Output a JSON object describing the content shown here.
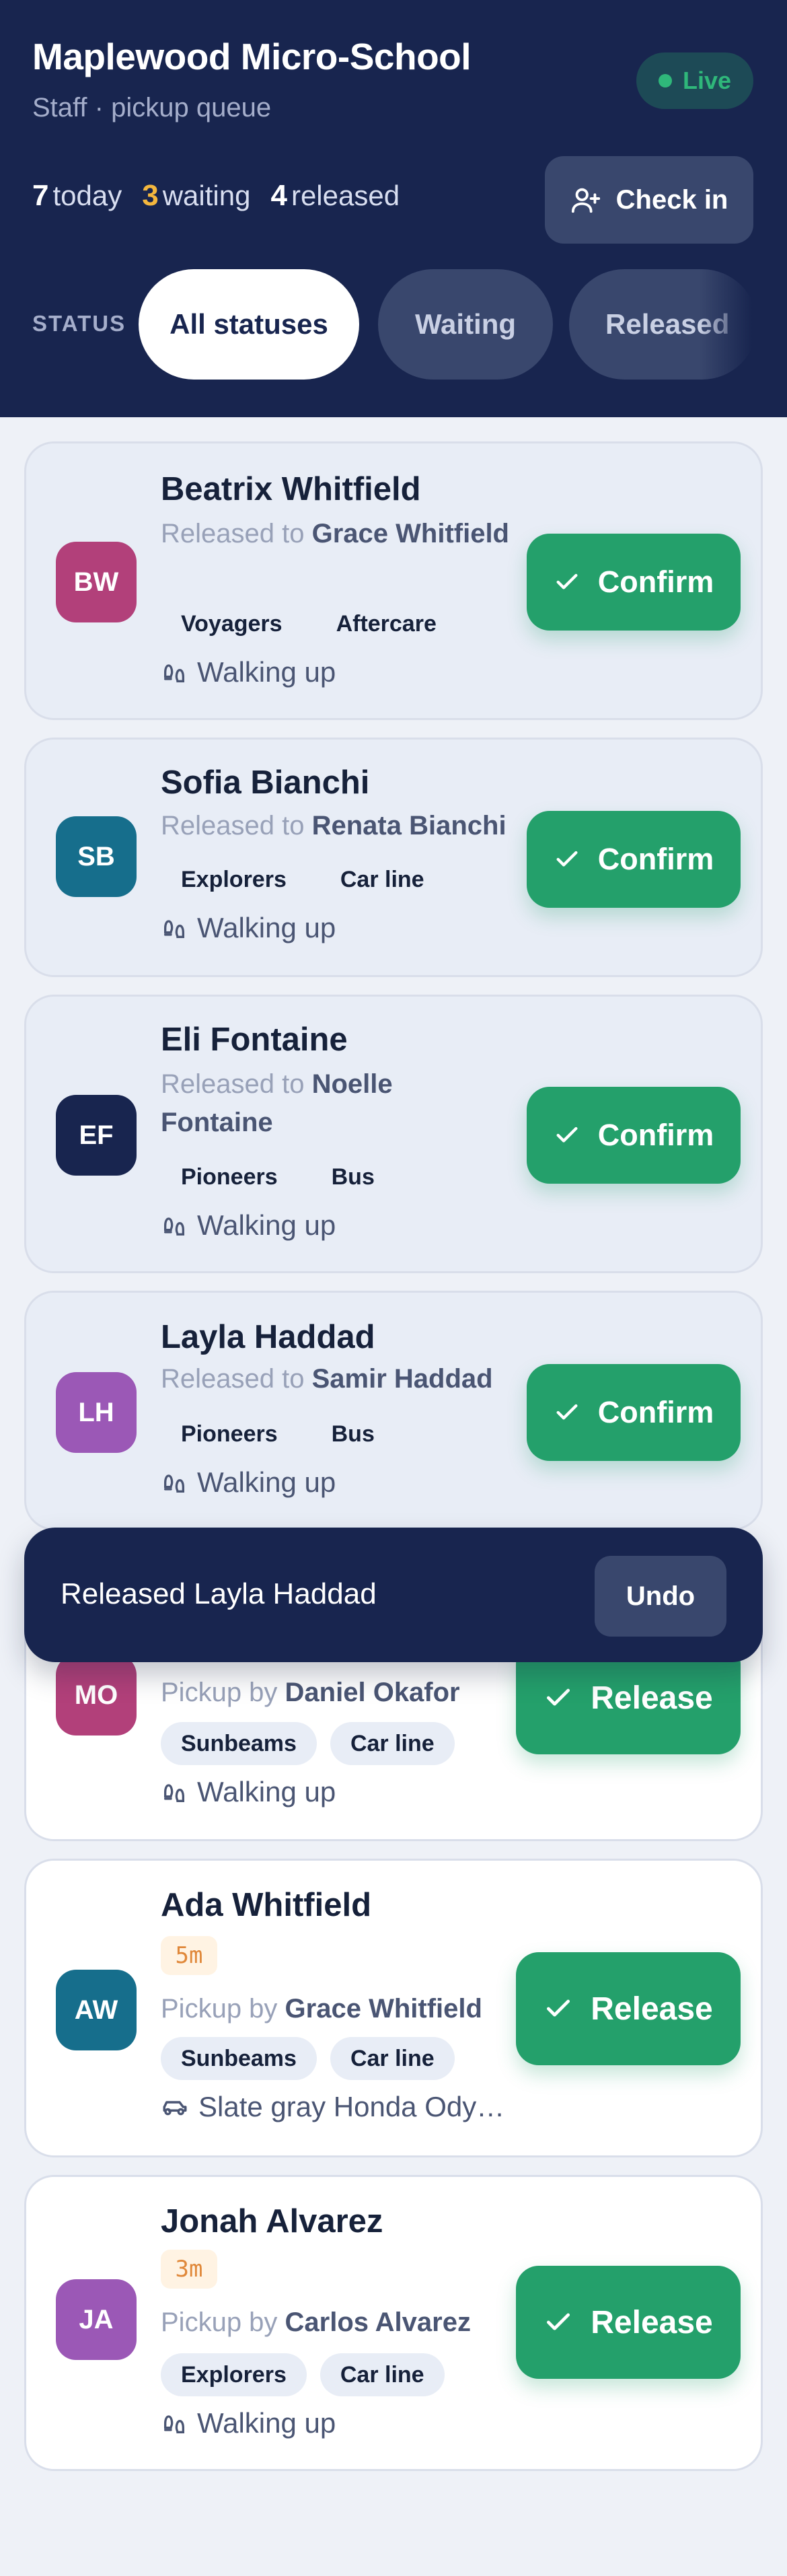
{
  "header": {
    "title": "Maplewood Micro-School",
    "subtitle": "Staff · pickup queue",
    "live_label": "Live",
    "counts": [
      {
        "num": "7",
        "label": "today"
      },
      {
        "num": "3",
        "label": "waiting"
      },
      {
        "num": "4",
        "label": "released"
      }
    ],
    "checkin_label": "Check in",
    "filter_label": "STATUS",
    "filters": [
      "All statuses",
      "Waiting",
      "Released"
    ]
  },
  "cards": [
    {
      "initials": "BW",
      "name": "Beatrix Whitfield",
      "prefix": "Released to",
      "person": "Grace Whitfield",
      "tags": [
        "Voyagers",
        "Aftercare"
      ],
      "arrival": "Walking up",
      "action": "Confirm",
      "avatar_color": "#b2407a"
    },
    {
      "initials": "SB",
      "name": "Sofia Bianchi",
      "prefix": "Released to",
      "person": "Renata Bianchi",
      "tags": [
        "Explorers",
        "Car line"
      ],
      "arrival": "Walking up",
      "action": "Confirm",
      "avatar_color": "#166e8c"
    },
    {
      "initials": "EF",
      "name": "Eli Fontaine",
      "prefix": "Released to",
      "person": "Noelle Fontaine",
      "tags": [
        "Pioneers",
        "Bus"
      ],
      "arrival": "Walking up",
      "action": "Confirm",
      "avatar_color": "#18254f"
    },
    {
      "initials": "LH",
      "name": "Layla Haddad",
      "prefix": "Released to",
      "person": "Samir Haddad",
      "tags": [
        "Pioneers",
        "Bus"
      ],
      "arrival": "Walking up",
      "action": "Confirm",
      "avatar_color": "#9b58b6"
    },
    {
      "initials": "MO",
      "prefix": "Pickup by",
      "person": "Daniel Okafor",
      "tags": [
        "Sunbeams",
        "Car line"
      ],
      "arrival": "Walking up",
      "action": "Release",
      "avatar_color": "#b2407a"
    },
    {
      "initials": "AW",
      "name": "Ada Whitfield",
      "eta": "5m",
      "prefix": "Pickup by",
      "person": "Grace Whitfield",
      "tags": [
        "Sunbeams",
        "Car line"
      ],
      "arrival": "Slate gray Honda Ody…",
      "action": "Release",
      "avatar_color": "#166e8c"
    },
    {
      "initials": "JA",
      "name": "Jonah Alvarez",
      "eta": "3m",
      "prefix": "Pickup by",
      "person": "Carlos Alvarez",
      "tags": [
        "Explorers",
        "Car line"
      ],
      "arrival": "Walking up",
      "action": "Release",
      "avatar_color": "#9b58b6"
    }
  ],
  "toast": {
    "message": "Released Layla Haddad",
    "undo_label": "Undo"
  },
  "colors": {
    "header_bg": "#18254f",
    "accent_green": "#24a06b",
    "waiting_count": "#f4b73e",
    "eta_text": "#e0883a"
  }
}
